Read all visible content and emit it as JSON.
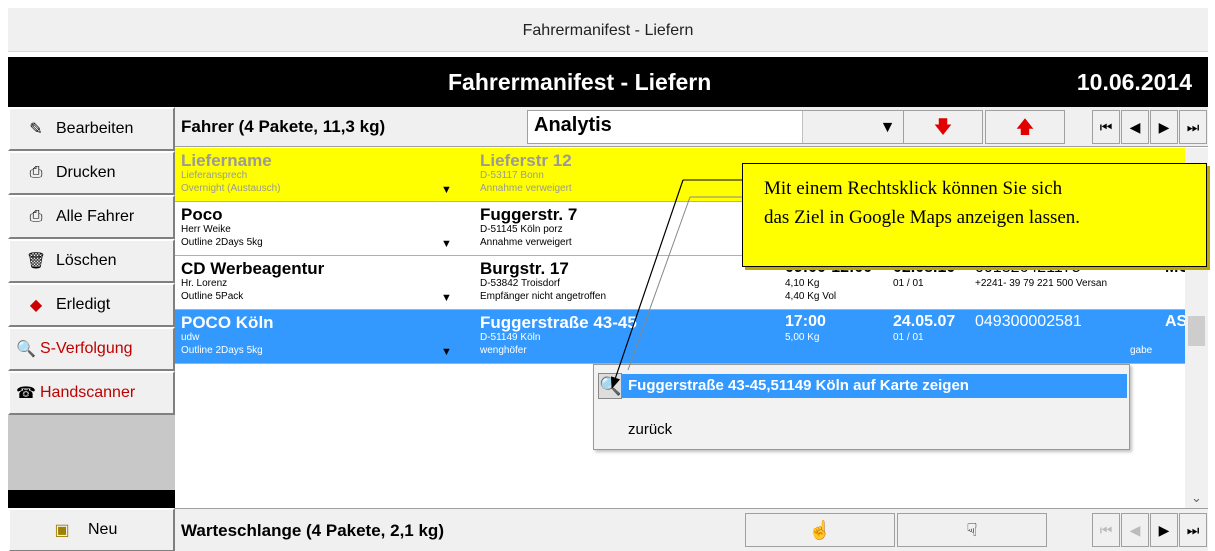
{
  "window": {
    "title": "Fahrermanifest - Liefern"
  },
  "header": {
    "title": "Fahrermanifest - Liefern",
    "date": "10.06.2014"
  },
  "sidebar": {
    "items": [
      {
        "label": "Bearbeiten",
        "icon": "edit-icon"
      },
      {
        "label": "Drucken",
        "icon": "printer-icon"
      },
      {
        "label": "Alle Fahrer",
        "icon": "printer-icon"
      },
      {
        "label": "Löschen",
        "icon": "trash-icon"
      },
      {
        "label": "Erledigt",
        "icon": "eraser-icon"
      },
      {
        "label": "S-Verfolgung",
        "icon": "magnifier-icon"
      },
      {
        "label": "Handscanner",
        "icon": "scanner-icon"
      },
      {
        "label": "Neu",
        "icon": "package-icon"
      }
    ]
  },
  "toolbar": {
    "title": "Fahrer (4 Pakete,  11,3 kg)",
    "combo_value": "Analytis"
  },
  "rows": [
    {
      "name": "Liefername",
      "contact": "Lieferansprech",
      "service": "Overnight (Austausch)",
      "street": "Lieferstr 12",
      "city": "D-53117 Bonn",
      "status": "Annahme verweigert"
    },
    {
      "name": "Poco",
      "contact": "Herr Weike",
      "service": "Outline 2Days 5kg",
      "street": "Fuggerstr. 7",
      "city": "D-51145 Köln porz",
      "status": "Annahme verweigert"
    },
    {
      "name": "CD  Werbeagentur",
      "contact": "Hr. Lorenz",
      "service": "Outline 5Pack",
      "street": "Burgstr. 17",
      "city": "D-53842 Troisdorf",
      "status": "Empfänger nicht angetroffen",
      "time": "09:00-12:00",
      "weight": "4,10 Kg",
      "volweight": "4,40 Kg Vol",
      "date": "02.08.10",
      "tracking": "001326421175",
      "count": "01 / 01",
      "phone": "+2241- 39 79 221 500 Versan",
      "code": "MG"
    },
    {
      "name": "POCO Köln",
      "contact": "udw",
      "service": "Outline 2Days 5kg",
      "street": "Fuggerstraße 43-45",
      "city": "D-51149 Köln",
      "status": "wenghöfer",
      "time": "17:00",
      "weight": "5,00 Kg",
      "date": "24.05.07",
      "tracking": "049300002581",
      "count": "01 / 01",
      "code": "AS",
      "extra": "gabe"
    }
  ],
  "context_menu": {
    "show_map": "Fuggerstraße 43-45,51149 Köln auf Karte zeigen",
    "back": "zurück"
  },
  "callout": {
    "line1": "Mit einem Rechtsklick können Sie sich",
    "line2": "das Ziel in Google Maps anzeigen lassen."
  },
  "bottom": {
    "title": "Warteschlange (4 Pakete,  2,1 kg)"
  },
  "colors": {
    "selected": "#3399ff",
    "highlight": "#ffff00",
    "arrow_red": "#e00000"
  }
}
